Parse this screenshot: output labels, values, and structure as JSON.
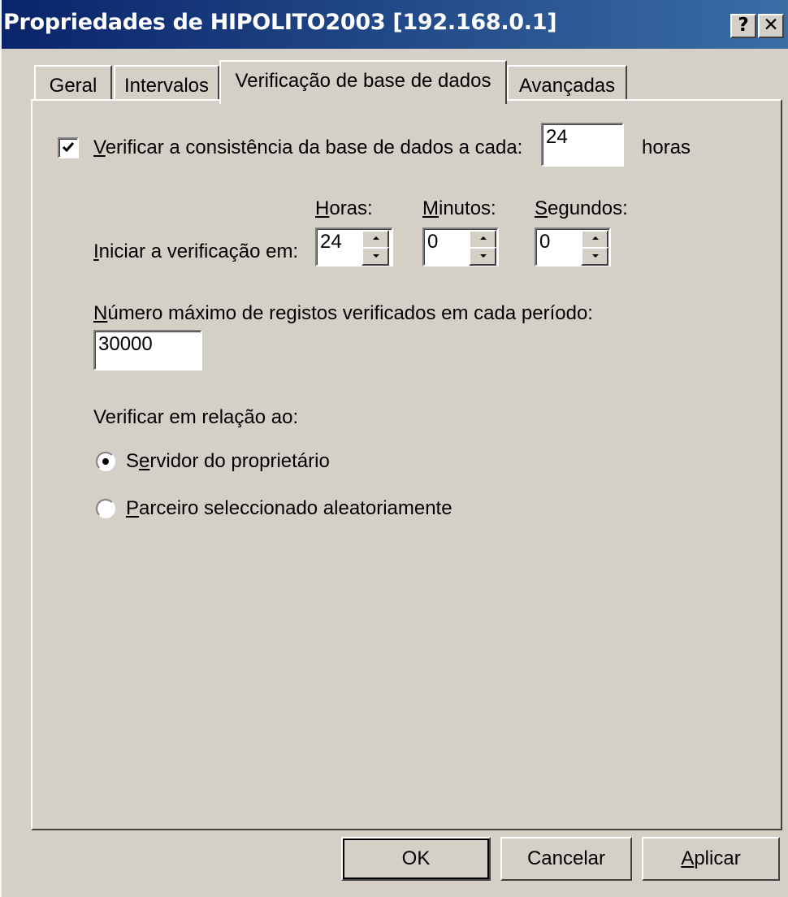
{
  "window": {
    "title": "Propriedades de HIPOLITO2003 [192.168.0.1]",
    "help_button": "?",
    "close_button": "✕"
  },
  "tabs": [
    {
      "label": "Geral",
      "selected": false
    },
    {
      "label": "Intervalos",
      "selected": false
    },
    {
      "label": "Verificação de base de dados",
      "selected": true
    },
    {
      "label": "Avançadas",
      "selected": false
    }
  ],
  "consistency": {
    "checked": true,
    "label_hotkey": "V",
    "label_rest": "erificar a consistência da base de dados a cada:",
    "value": "24",
    "unit": "horas"
  },
  "start_time": {
    "label_hotkey": "I",
    "label_rest": "niciar a verificação em:",
    "hours_hotkey": "H",
    "hours_rest": "oras:",
    "hours_value": "24",
    "minutes_hotkey": "M",
    "minutes_rest": "inutos:",
    "minutes_value": "0",
    "seconds_hotkey": "S",
    "seconds_rest": "egundos:",
    "seconds_value": "0"
  },
  "max_records": {
    "label_hotkey": "N",
    "label_rest": "úmero máximo de registos verificados em cada período:",
    "value": "30000"
  },
  "verify_against": {
    "label": "Verificar em relação ao:",
    "options": [
      {
        "pre": "S",
        "hotkey": "e",
        "post": "rvidor do proprietário",
        "selected": true
      },
      {
        "pre": "",
        "hotkey": "P",
        "post": "arceiro seleccionado aleatoriamente",
        "selected": false
      }
    ]
  },
  "buttons": {
    "ok": "OK",
    "cancel": "Cancelar",
    "apply_hotkey": "A",
    "apply_rest": "plicar"
  }
}
